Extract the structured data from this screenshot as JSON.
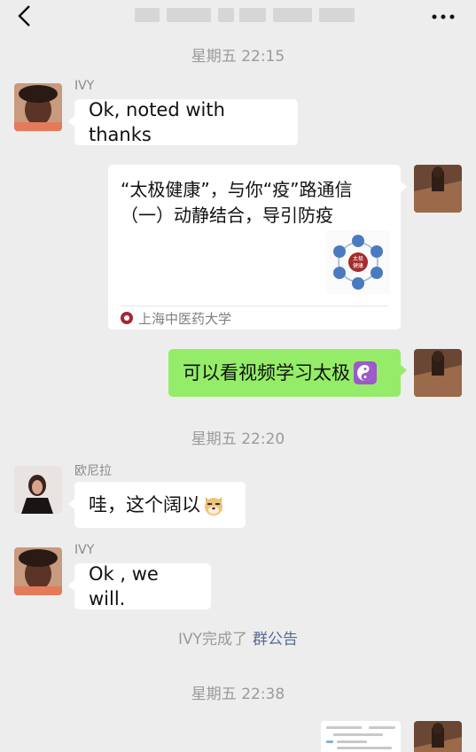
{
  "header": {
    "back_icon": "chevron-left-icon",
    "more_icon": "more-dots-icon"
  },
  "timestamps": [
    "星期五 22:15",
    "星期五 22:20",
    "星期五 22:38"
  ],
  "messages": [
    {
      "sender": "IVY",
      "text": "Ok, noted with thanks"
    },
    {
      "card_title": "“太极健康”，与你“疫”路通信（一）动静结合，导引防疫",
      "card_source": "上海中医药大学",
      "thumb_labels": [
        "太极",
        "健康"
      ]
    },
    {
      "text": "可以看视频学习太极",
      "emoji": "yin-yang-icon"
    },
    {
      "sender": "欧尼拉",
      "text": "哇，这个阔以",
      "emoji": "doge-icon"
    },
    {
      "sender": "IVY",
      "text": "Ok , we will."
    }
  ],
  "system_notice": {
    "text": "IVY完成了",
    "link": "群公告"
  },
  "colors": {
    "background": "#ededed",
    "self_bubble": "#95ec69",
    "link": "#576b95"
  }
}
